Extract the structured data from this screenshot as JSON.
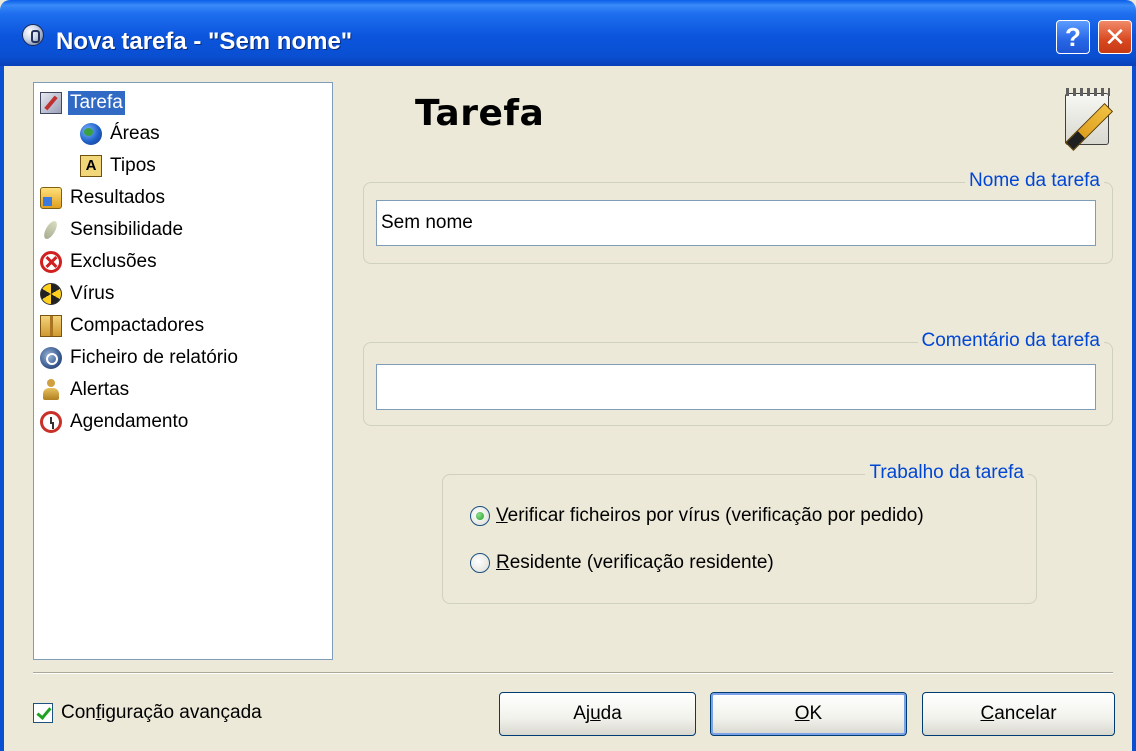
{
  "window": {
    "title": "Nova tarefa - \"Sem nome\"",
    "help_button": "?",
    "close_button": "✕"
  },
  "tree": {
    "items": [
      {
        "label": "Tarefa",
        "icon": "edit-icon",
        "selected": true
      },
      {
        "label": "Áreas",
        "icon": "globe-icon"
      },
      {
        "label": "Tipos",
        "icon": "types-icon",
        "icon_text": "A"
      },
      {
        "label": "Resultados",
        "icon": "results-icon"
      },
      {
        "label": "Sensibilidade",
        "icon": "feather-icon"
      },
      {
        "label": "Exclusões",
        "icon": "exclude-icon"
      },
      {
        "label": "Vírus",
        "icon": "virus-icon"
      },
      {
        "label": "Compactadores",
        "icon": "box-icon"
      },
      {
        "label": "Ficheiro de relatório",
        "icon": "report-icon"
      },
      {
        "label": "Alertas",
        "icon": "alert-icon"
      },
      {
        "label": "Agendamento",
        "icon": "clock-icon"
      }
    ]
  },
  "main": {
    "title": "Tarefa",
    "name_group": {
      "legend": "Nome da tarefa",
      "value": "Sem nome"
    },
    "comment_group": {
      "legend": "Comentário da tarefa",
      "value": ""
    },
    "work_group": {
      "legend": "Trabalho da tarefa",
      "options": [
        {
          "mnemonic": "V",
          "rest": "erificar ficheiros por vírus (verificação por pedido)",
          "checked": true
        },
        {
          "mnemonic": "R",
          "rest": "esidente (verificação residente)",
          "checked": false
        }
      ]
    }
  },
  "footer": {
    "advanced": {
      "pre": "Con",
      "mnemonic": "f",
      "post": "iguração avançada",
      "checked": true
    },
    "buttons": {
      "help": {
        "pre": "Aj",
        "mnemonic": "u",
        "post": "da"
      },
      "ok": {
        "pre": "",
        "mnemonic": "O",
        "post": "K"
      },
      "cancel": {
        "pre": "",
        "mnemonic": "C",
        "post": "ancelar"
      }
    }
  },
  "colors": {
    "titlebar": "#0a4fd2",
    "selection": "#316ac5",
    "legend_text": "#0046d5",
    "window_bg": "#ece9d8"
  }
}
